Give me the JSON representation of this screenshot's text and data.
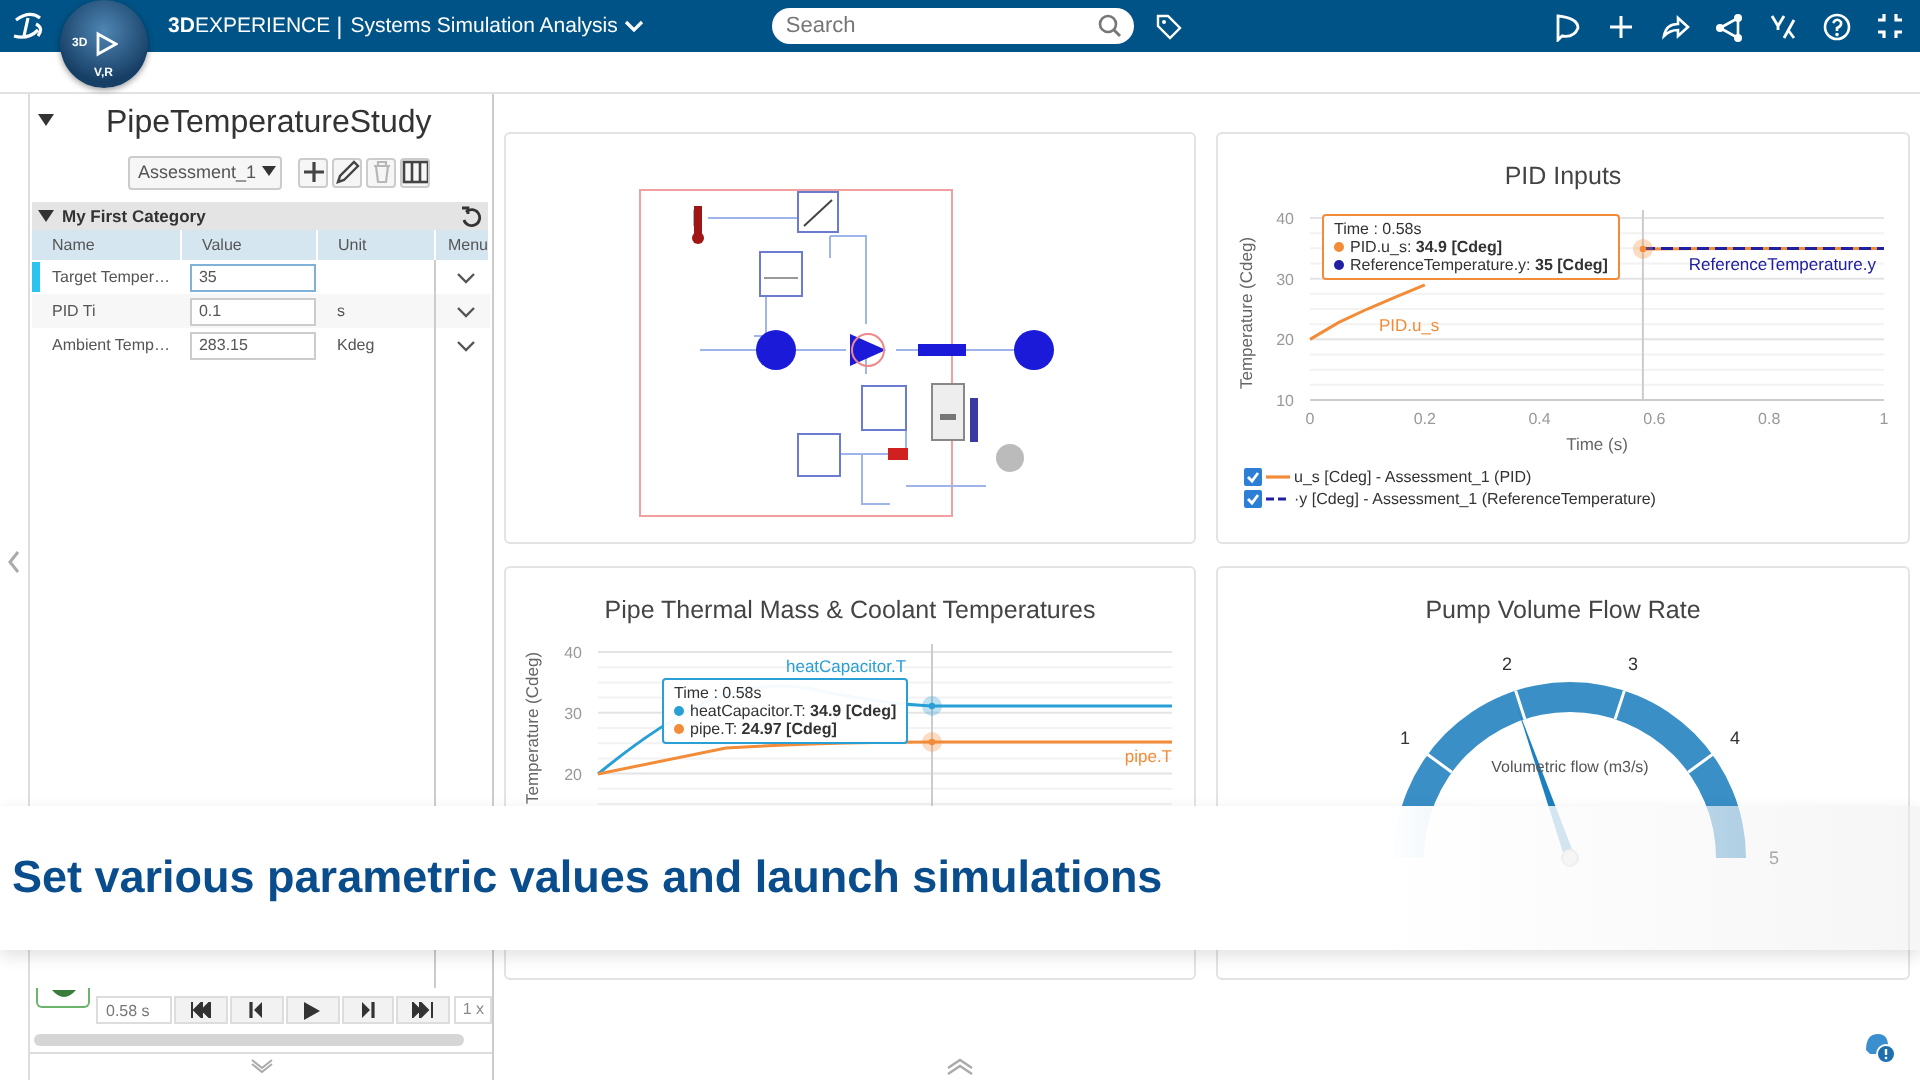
{
  "header": {
    "brand": "**3D**EXPERIENCE",
    "separator": "|",
    "app": "Systems Simulation Analysis",
    "compass": [
      "3D",
      "V,R"
    ],
    "search": {
      "placeholder": "Search"
    }
  },
  "study": {
    "title": "PipeTemperatureStudy",
    "expanded": true,
    "assessment": "Assessment_1",
    "tools": [
      {
        "kind": "add",
        "disabled": false
      },
      {
        "kind": "edit",
        "disabled": false
      },
      {
        "kind": "delete",
        "disabled": true
      },
      {
        "kind": "columns",
        "disabled": false
      }
    ],
    "category": {
      "title": "My First Category",
      "expanded": true
    },
    "columns": [
      "Name",
      "Value",
      "Unit",
      "Menu"
    ],
    "rows": [
      {
        "name": "Target Temper…",
        "value": "35",
        "unit": "",
        "selected": true
      },
      {
        "name": "PID Ti",
        "value": "0.1",
        "unit": "s",
        "selected": false
      },
      {
        "name": "Ambient Temp…",
        "value": "283.15",
        "unit": "Kdeg",
        "selected": false
      }
    ]
  },
  "playback": {
    "time": "0.58 s",
    "speed": "1 x"
  },
  "panels": [
    {
      "kind": "diagram"
    },
    {
      "kind": "line",
      "title": "PID Inputs",
      "chart_data": {
        "type": "line",
        "xlabel": "Time (s)",
        "ylabel": "Temperature (Cdeg)",
        "x": [
          0,
          0.05,
          0.1,
          0.15,
          0.2,
          0.25,
          0.3,
          0.4,
          0.5,
          0.58,
          0.7,
          0.8,
          0.9,
          1
        ],
        "xlim": [
          0,
          1
        ],
        "ylim": [
          10,
          40
        ],
        "xticks": [
          0,
          0.2,
          0.4,
          0.6,
          0.8,
          1
        ],
        "yticks": [
          10,
          20,
          30,
          40
        ],
        "series": [
          {
            "name": "PID.u_s",
            "color": "#f28c38",
            "line_style": "solid",
            "values": [
              20,
              22.8,
              25,
              27,
              29,
              null,
              null,
              null,
              null,
              34.9,
              35,
              35,
              35,
              35
            ]
          },
          {
            "name": "ReferenceTemperature.y",
            "color": "#2020a0",
            "line_style": "dashed",
            "values": [
              null,
              null,
              null,
              null,
              null,
              null,
              null,
              null,
              null,
              35,
              35,
              35,
              35,
              35
            ]
          }
        ],
        "ref_lines": [
          {
            "axis": "x",
            "value": 0.58
          }
        ]
      },
      "tooltip": {
        "title": "Time : 0.58s",
        "items": [
          {
            "text": "PID.u_s: **34.9 [Cdeg]**",
            "color": "#f28c38"
          },
          {
            "text": "ReferenceTemperature.y: **35 [Cdeg]**",
            "color": "#2020a0"
          }
        ]
      },
      "legend": [
        {
          "label": "u_s [Cdeg] - Assessment_1 (PID)",
          "checked": true,
          "color": "#f28c38",
          "dashed": false
        },
        {
          "label": "·y [Cdeg] - Assessment_1 (ReferenceTemperature)",
          "checked": true,
          "color": "#2020a0",
          "dashed": true
        }
      ]
    },
    {
      "kind": "curves",
      "title": "Pipe Thermal Mass & Coolant Temperatures",
      "ylabel": "Temperature (Cdeg)",
      "y_labels": [
        "40",
        "30",
        "20"
      ],
      "line_labels": [
        {
          "text": "heatCapacitor.T",
          "color": "#2a9fd6"
        },
        {
          "text": "pipe.T",
          "color": "#f28c38"
        }
      ],
      "tooltip": {
        "title": "Time : 0.58s",
        "items": [
          {
            "text": "heatCapacitor.T: **34.9 [Cdeg]**",
            "color": "#2a9fd6"
          },
          {
            "text": "pipe.T: **24.97 [Cdeg]**",
            "color": "#f28c38"
          }
        ]
      }
    },
    {
      "kind": "gauge",
      "title": "Pump Volume Flow Rate",
      "label": "Volumetric flow (m3/s)",
      "ticks": [
        "1",
        "2",
        "3",
        "4",
        "5"
      ],
      "level": 0.393
    }
  ],
  "caption": "Set various parametric values and launch simulations"
}
